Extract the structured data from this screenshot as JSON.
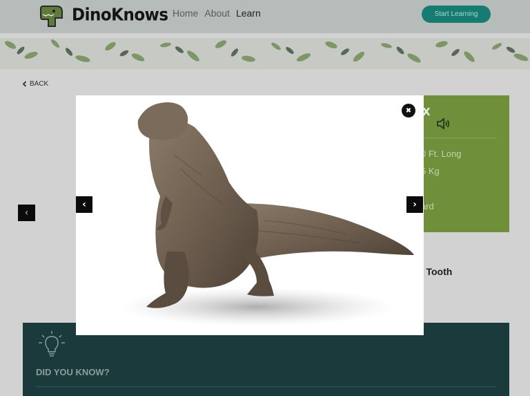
{
  "header": {
    "logo_text": "DinoKnows",
    "nav": [
      "Home",
      "About",
      "Learn"
    ],
    "active_nav": "Learn",
    "cta_label": "Start Learning"
  },
  "back_label": "BACK",
  "info_panel": {
    "title_fragment": "X",
    "length_fragment": "0 Ft. Long",
    "weight_fragment": "5 Kg",
    "diet_fragment": "ard"
  },
  "tooth_label_fragment": "ex Tooth",
  "did_you_know": {
    "title": "DID YOU KNOW?"
  },
  "modal": {
    "close_glyph": "✖",
    "prev_glyph": "‹",
    "next_glyph": "›"
  },
  "bg_prev_glyph": "‹",
  "colors": {
    "header_bg": "#b6bcba",
    "cta_bg": "#167c72",
    "info_panel_bg": "#6f8f3a",
    "dyk_bg": "#1a3a3b"
  }
}
